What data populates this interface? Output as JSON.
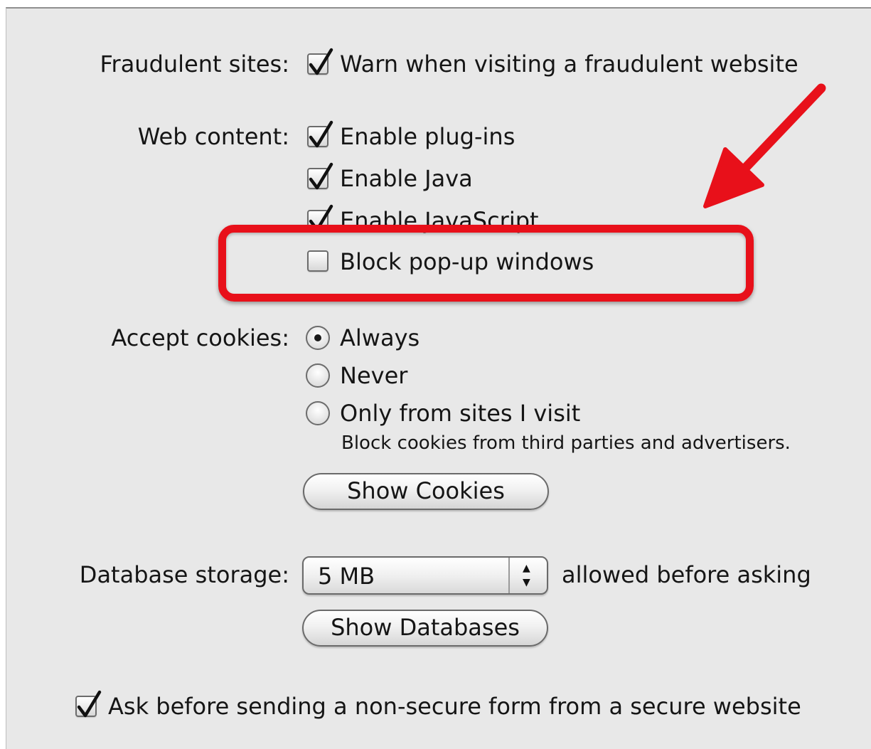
{
  "fraudulent": {
    "label": "Fraudulent sites:",
    "option": "Warn when visiting a fraudulent website",
    "checked": true
  },
  "web_content": {
    "label": "Web content:",
    "options": [
      {
        "label": "Enable plug-ins",
        "checked": true
      },
      {
        "label": "Enable Java",
        "checked": true
      },
      {
        "label": "Enable JavaScript",
        "checked": true
      },
      {
        "label": "Block pop-up windows",
        "checked": false
      }
    ]
  },
  "cookies": {
    "label": "Accept cookies:",
    "options": [
      {
        "label": "Always",
        "selected": true
      },
      {
        "label": "Never",
        "selected": false
      },
      {
        "label": "Only from sites I visit",
        "selected": false
      }
    ],
    "note": "Block cookies from third parties and advertisers.",
    "show_button": "Show Cookies"
  },
  "database": {
    "label": "Database storage:",
    "selected_value": "5 MB",
    "suffix": "allowed before asking",
    "show_button": "Show Databases"
  },
  "nonsecure": {
    "label": "Ask before sending a non-secure form from a secure website",
    "checked": true
  },
  "annotation": {
    "color": "#e8101a",
    "icons": [
      "highlight-box",
      "arrow-icon"
    ]
  }
}
